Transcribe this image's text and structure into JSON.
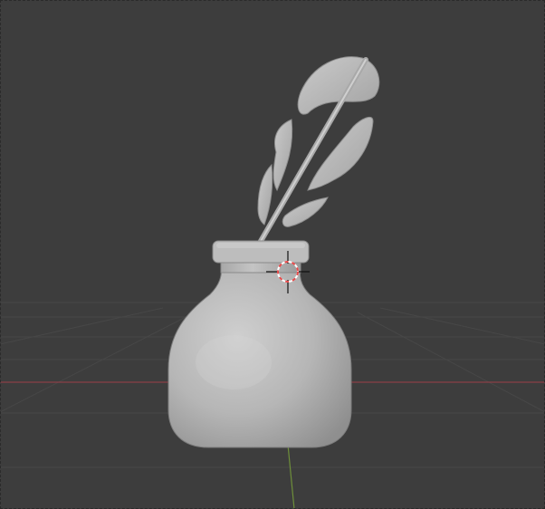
{
  "viewport": {
    "background": "#3d3d3d",
    "grid_color": "#4a4a4a",
    "x_axis_color": "#8a3f47",
    "y_axis_color": "#6e8f3a"
  },
  "scene": {
    "objects": [
      {
        "name": "inkwell-bottle"
      },
      {
        "name": "quill-feather"
      }
    ],
    "mesh_color": "#b9b9b9"
  },
  "cursor": {
    "type": "3d-cursor-icon",
    "ring_colors": [
      "#e64a4a",
      "#ffffff"
    ]
  }
}
